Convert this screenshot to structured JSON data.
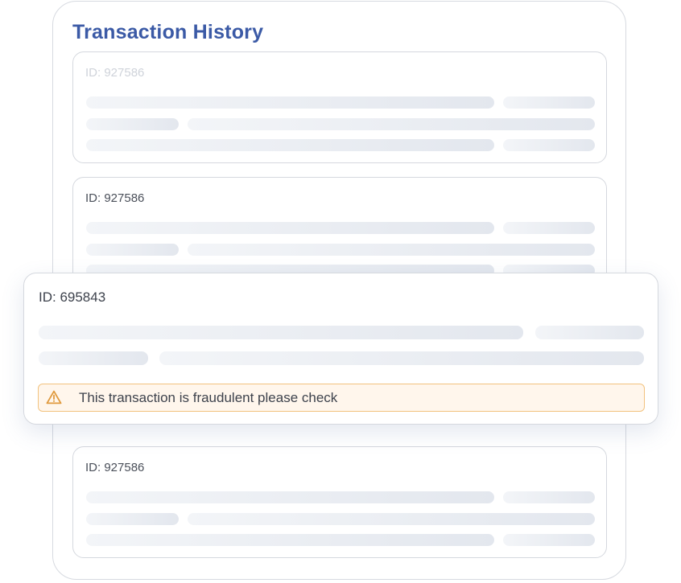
{
  "panel": {
    "title": "Transaction History"
  },
  "transactions": [
    {
      "id_text": "ID: 927586",
      "state": "faded"
    },
    {
      "id_text": "ID: 927586",
      "state": "normal"
    },
    {
      "id_text": "ID: 695843",
      "state": "flagged"
    },
    {
      "id_text": "ID: 927586",
      "state": "normal"
    }
  ],
  "alert": {
    "message": "This transaction is fraudulent please check",
    "icon": "warning-triangle-icon"
  },
  "colors": {
    "title": "#3b5aa6",
    "alert_border": "#f2c27e",
    "alert_background": "#fff6ec",
    "alert_icon": "#e09a3e",
    "skeleton": "#e3e7ee"
  }
}
